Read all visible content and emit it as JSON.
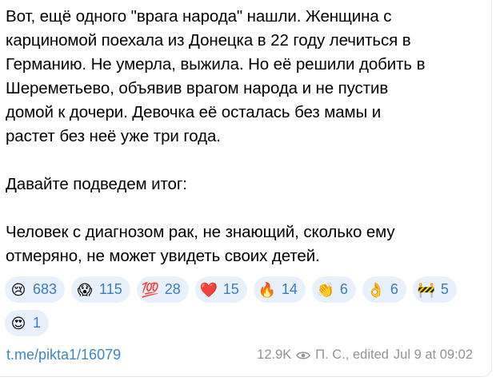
{
  "message": {
    "lines_p1": [
      "Вот, ещё одного \"врага народа\" нашли. Женщина с",
      "карциномой поехала из Донецка в 22 году лечиться в",
      "Германию. Не умерла, выжила. Но её решили добить в",
      "Шереметьево, объявив врагом народа и не пустив",
      "домой к дочери. Девочка её осталась без мамы и",
      "растет без неё уже три года."
    ],
    "line_p2": "Давайте подведем итог:",
    "lines_p3": [
      "Человек с диагнозом рак, не знающий, сколько ему",
      "отмеряно, не может увидеть своих детей."
    ]
  },
  "reactions": [
    {
      "icon": "crying-face-icon",
      "emoji": "😢",
      "count": "683"
    },
    {
      "icon": "screaming-face-icon",
      "emoji": "😱",
      "count": "115"
    },
    {
      "icon": "hundred-points-icon",
      "emoji": "💯",
      "count": "28"
    },
    {
      "icon": "red-heart-icon",
      "emoji": "❤️",
      "count": "15"
    },
    {
      "icon": "fire-icon",
      "emoji": "🔥",
      "count": "14"
    },
    {
      "icon": "clapping-hands-icon",
      "emoji": "👏",
      "count": "6"
    },
    {
      "icon": "ok-hand-icon",
      "emoji": "👌",
      "count": "6"
    },
    {
      "icon": "broken-doll-icon",
      "emoji": "🚧",
      "count": "5"
    },
    {
      "icon": "heart-eyes-icon",
      "emoji": "😍",
      "count": "1"
    }
  ],
  "footer": {
    "link": "t.me/pikta1/16079",
    "views": "12.9K",
    "author": "П. С., edited",
    "time": "Jul 9 at 09:02"
  },
  "colors": {
    "accent": "#3a86c8",
    "reaction_bg": "#e8f1fb",
    "meta": "#8d9399"
  }
}
